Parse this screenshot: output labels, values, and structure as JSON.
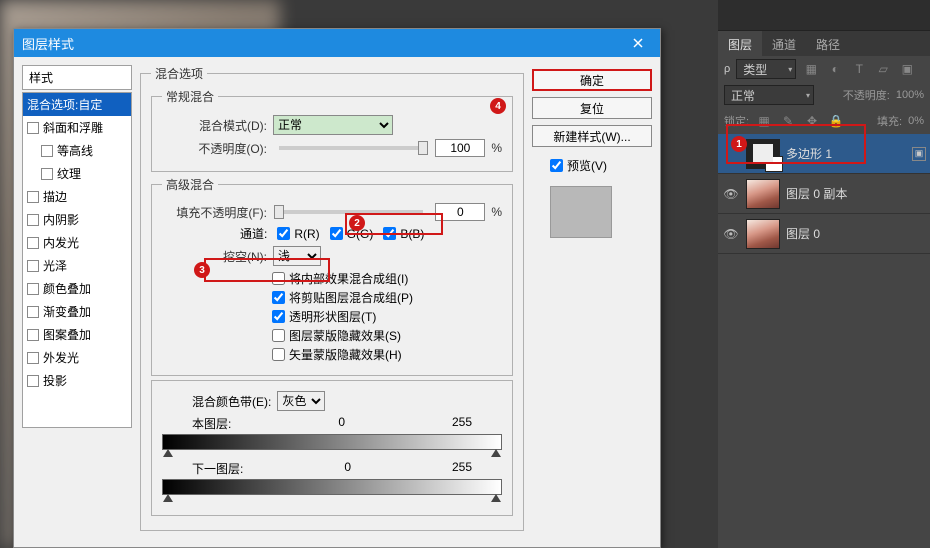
{
  "dialog": {
    "title": "图层样式",
    "styles_header": "样式",
    "styles": [
      {
        "label": "混合选项:自定",
        "selected": true,
        "checkbox": false,
        "indent": false
      },
      {
        "label": "斜面和浮雕",
        "selected": false,
        "checkbox": true,
        "indent": false
      },
      {
        "label": "等高线",
        "selected": false,
        "checkbox": true,
        "indent": true
      },
      {
        "label": "纹理",
        "selected": false,
        "checkbox": true,
        "indent": true
      },
      {
        "label": "描边",
        "selected": false,
        "checkbox": true,
        "indent": false
      },
      {
        "label": "内阴影",
        "selected": false,
        "checkbox": true,
        "indent": false
      },
      {
        "label": "内发光",
        "selected": false,
        "checkbox": true,
        "indent": false
      },
      {
        "label": "光泽",
        "selected": false,
        "checkbox": true,
        "indent": false
      },
      {
        "label": "颜色叠加",
        "selected": false,
        "checkbox": true,
        "indent": false
      },
      {
        "label": "渐变叠加",
        "selected": false,
        "checkbox": true,
        "indent": false
      },
      {
        "label": "图案叠加",
        "selected": false,
        "checkbox": true,
        "indent": false
      },
      {
        "label": "外发光",
        "selected": false,
        "checkbox": true,
        "indent": false
      },
      {
        "label": "投影",
        "selected": false,
        "checkbox": true,
        "indent": false
      }
    ],
    "blend_options_legend": "混合选项",
    "general_legend": "常规混合",
    "blend_mode_label": "混合模式(D):",
    "blend_mode_value": "正常",
    "opacity_label": "不透明度(O):",
    "opacity_value": "100",
    "percent": "%",
    "advanced_legend": "高级混合",
    "fill_opacity_label": "填充不透明度(F):",
    "fill_opacity_value": "0",
    "channels_label": "通道:",
    "ch_r": "R(R)",
    "ch_g": "G(G)",
    "ch_b": "B(B)",
    "knockout_label": "挖空(N):",
    "knockout_value": "浅",
    "adv_checks": [
      {
        "label": "将内部效果混合成组(I)",
        "checked": false
      },
      {
        "label": "将剪贴图层混合成组(P)",
        "checked": true
      },
      {
        "label": "透明形状图层(T)",
        "checked": true
      },
      {
        "label": "图层蒙版隐藏效果(S)",
        "checked": false
      },
      {
        "label": "矢量蒙版隐藏效果(H)",
        "checked": false
      }
    ],
    "blendif_label": "混合颜色带(E):",
    "blendif_value": "灰色",
    "this_layer_label": "本图层:",
    "under_layer_label": "下一图层:",
    "range_min": "0",
    "range_max": "255",
    "buttons": {
      "ok": "确定",
      "reset": "复位",
      "new_style": "新建样式(W)...",
      "preview": "预览(V)"
    }
  },
  "callouts": {
    "c1": "1",
    "c2": "2",
    "c3": "3",
    "c4": "4"
  },
  "panel": {
    "tabs": [
      "图层",
      "通道",
      "路径"
    ],
    "kind_label": "类型",
    "mode": "正常",
    "opacity_label": "不透明度:",
    "opacity_value": "100%",
    "lock_label": "锁定:",
    "fill_label": "填充:",
    "fill_value": "0%",
    "layers": [
      {
        "name": "多边形 1",
        "selected": true,
        "eye": false,
        "thumb": "shape"
      },
      {
        "name": "图层 0 副本",
        "selected": false,
        "eye": true,
        "thumb": "img"
      },
      {
        "name": "图层 0",
        "selected": false,
        "eye": true,
        "thumb": "img"
      }
    ]
  }
}
